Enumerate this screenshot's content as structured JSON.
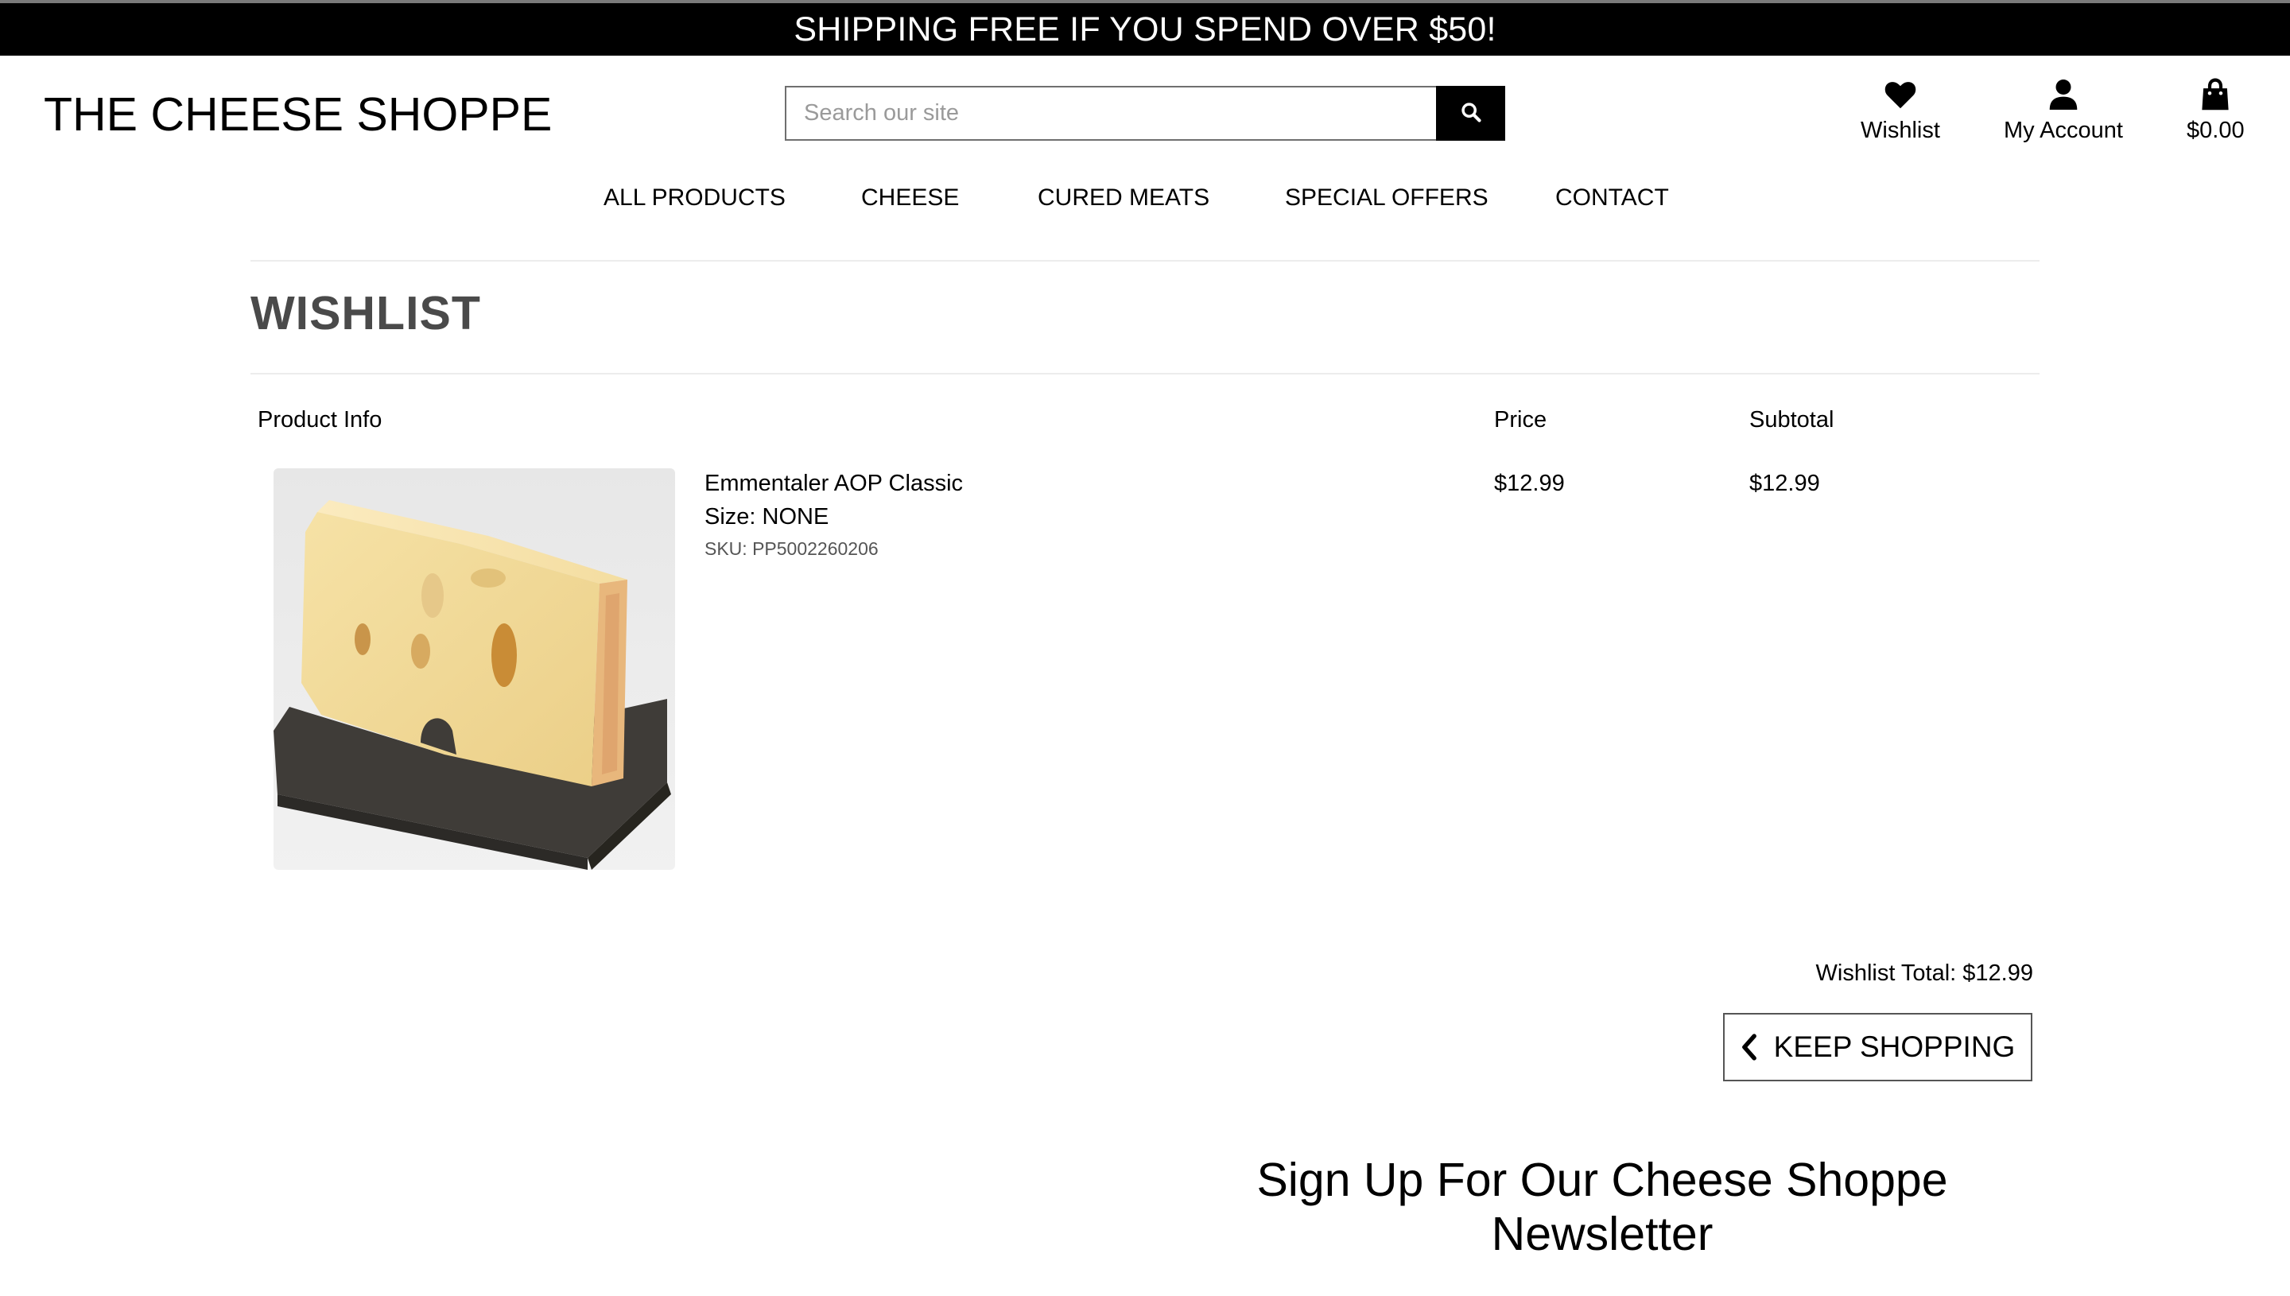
{
  "banner": {
    "text": "SHIPPING FREE IF YOU SPEND OVER $50!"
  },
  "header": {
    "logo": "THE CHEESE SHOPPE",
    "search": {
      "placeholder": "Search our site",
      "value": ""
    },
    "wishlist_label": "Wishlist",
    "account_label": "My Account",
    "bag_total": "$0.00"
  },
  "nav": {
    "items": [
      "ALL PRODUCTS",
      "CHEESE",
      "CURED MEATS",
      "SPECIAL OFFERS",
      "CONTACT"
    ]
  },
  "page": {
    "title": "WISHLIST"
  },
  "table": {
    "headers": {
      "product_info": "Product Info",
      "price": "Price",
      "subtotal": "Subtotal"
    },
    "rows": [
      {
        "name": "Emmentaler AOP Classic",
        "size": "Size: NONE",
        "sku": "SKU: PP5002260206",
        "price": "$12.99",
        "subtotal": "$12.99"
      }
    ]
  },
  "summary": {
    "total": "Wishlist Total: $12.99",
    "keep_shopping": "KEEP SHOPPING"
  },
  "newsletter": {
    "line1": "Sign Up For Our Cheese Shoppe",
    "line2": "Newsletter"
  },
  "colors": {
    "banner_bg": "#000000",
    "banner_text": "#ffffff",
    "title_gray": "#4a4a4a",
    "divider": "#ececec"
  },
  "icons": [
    "search-icon",
    "heart-icon",
    "user-icon",
    "shopping-bag-icon",
    "chevron-left-icon"
  ]
}
